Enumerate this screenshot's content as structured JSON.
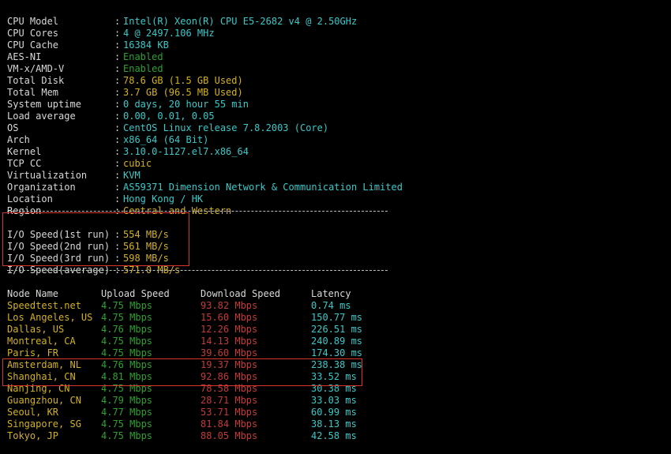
{
  "system_info": [
    {
      "label": "CPU Model",
      "value": "Intel(R) Xeon(R) CPU E5-2682 v4 @ 2.50GHz",
      "color": "cyan"
    },
    {
      "label": "CPU Cores",
      "value": "4 @ 2497.106 MHz",
      "color": "cyan"
    },
    {
      "label": "CPU Cache",
      "value": "16384 KB",
      "color": "cyan"
    },
    {
      "label": "AES-NI",
      "value": "Enabled",
      "color": "green"
    },
    {
      "label": "VM-x/AMD-V",
      "value": "Enabled",
      "color": "green"
    },
    {
      "label": "Total Disk",
      "value": "78.6 GB (1.5 GB Used)",
      "color": "yellow"
    },
    {
      "label": "Total Mem",
      "value": "3.7 GB (96.5 MB Used)",
      "color": "yellow"
    },
    {
      "label": "System uptime",
      "value": "0 days, 20 hour 55 min",
      "color": "cyan"
    },
    {
      "label": "Load average",
      "value": "0.00, 0.01, 0.05",
      "color": "cyan"
    },
    {
      "label": "OS",
      "value": "CentOS Linux release 7.8.2003 (Core)",
      "color": "cyan"
    },
    {
      "label": "Arch",
      "value": "x86_64 (64 Bit)",
      "color": "cyan"
    },
    {
      "label": "Kernel",
      "value": "3.10.0-1127.el7.x86_64",
      "color": "cyan"
    },
    {
      "label": "TCP CC",
      "value": "cubic",
      "color": "yellow"
    },
    {
      "label": "Virtualization",
      "value": "KVM",
      "color": "cyan"
    },
    {
      "label": "Organization",
      "value": "AS59371 Dimension Network & Communication Limited",
      "color": "cyan"
    },
    {
      "label": "Location",
      "value": "Hong Kong / HK",
      "color": "cyan"
    },
    {
      "label": "Region",
      "value": "Central and Western",
      "color": "yellow"
    }
  ],
  "io_speed": [
    {
      "label": "I/O Speed(1st run)",
      "value": "554 MB/s"
    },
    {
      "label": "I/O Speed(2nd run)",
      "value": "561 MB/s"
    },
    {
      "label": "I/O Speed(3rd run)",
      "value": "598 MB/s"
    },
    {
      "label": "I/O Speed(average)",
      "value": "571.0 MB/s"
    }
  ],
  "speed_table": {
    "headers": {
      "node": "Node Name",
      "upload": "Upload Speed",
      "download": "Download Speed",
      "latency": "Latency"
    },
    "rows": [
      {
        "node": "Speedtest.net",
        "upload": "4.75 Mbps",
        "download": "93.82 Mbps",
        "latency": "0.74 ms"
      },
      {
        "node": "Los Angeles, US",
        "upload": "4.75 Mbps",
        "download": "15.60 Mbps",
        "latency": "150.77 ms"
      },
      {
        "node": "Dallas, US",
        "upload": "4.76 Mbps",
        "download": "12.26 Mbps",
        "latency": "226.51 ms"
      },
      {
        "node": "Montreal, CA",
        "upload": "4.75 Mbps",
        "download": "14.13 Mbps",
        "latency": "240.89 ms"
      },
      {
        "node": "Paris, FR",
        "upload": "4.75 Mbps",
        "download": "39.60 Mbps",
        "latency": "174.30 ms"
      },
      {
        "node": "Amsterdam, NL",
        "upload": "4.76 Mbps",
        "download": "19.37 Mbps",
        "latency": "238.38 ms"
      },
      {
        "node": "Shanghai, CN",
        "upload": "4.81 Mbps",
        "download": "92.86 Mbps",
        "latency": "33.52 ms"
      },
      {
        "node": "Nanjing, CN",
        "upload": "4.75 Mbps",
        "download": "78.58 Mbps",
        "latency": "30.38 ms"
      },
      {
        "node": "Guangzhou, CN",
        "upload": "4.79 Mbps",
        "download": "28.71 Mbps",
        "latency": "33.03 ms"
      },
      {
        "node": "Seoul, KR",
        "upload": "4.77 Mbps",
        "download": "53.71 Mbps",
        "latency": "60.99 ms"
      },
      {
        "node": "Singapore, SG",
        "upload": "4.75 Mbps",
        "download": "81.84 Mbps",
        "latency": "38.13 ms"
      },
      {
        "node": "Tokyo, JP",
        "upload": "4.75 Mbps",
        "download": "88.05 Mbps",
        "latency": "42.58 ms"
      }
    ]
  },
  "colors": {
    "background": "#000000",
    "label": "#d8d8d8",
    "cyan": "#3ac9c9",
    "yellow": "#d3b21e",
    "green": "#2fa12f",
    "red": "#c43a3a",
    "highlight_border": "#d9342b"
  }
}
